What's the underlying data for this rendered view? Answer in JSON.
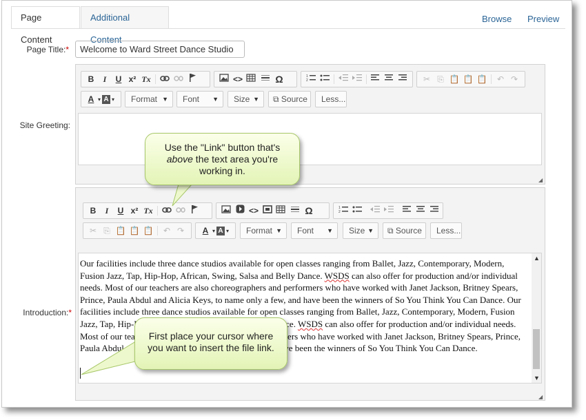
{
  "tabs": [
    {
      "label": "Page Content",
      "active": true
    },
    {
      "label": "Additional Content",
      "active": false
    }
  ],
  "top_links": {
    "browse": "Browse",
    "preview": "Preview"
  },
  "page_title": {
    "label": "Page Title:",
    "required_mark": "*",
    "value": "Welcome to Ward Street Dance Studio"
  },
  "site_greeting": {
    "label": "Site Greeting:"
  },
  "introduction": {
    "label": "Introduction:",
    "required_mark": "*",
    "p1": "Our facilities include three dance studios available for open classes ranging from Ballet, Jazz, Contemporary, Modern, Fusion Jazz, Tap, Hip-Hop, African, Swing, Salsa and Belly Dance. ",
    "wsds": "WSDS",
    "p2": " can also offer for production and/or individual needs. Most of our teachers are also choreographers and performers who have worked with Janet Jackson, Britney Spears, Prince, Paula Abdul and Alicia Keys, to name only a few, and have been the winners of So You Think You Can Dance. Our facilities include three dance studios available for open classes ranging from Ballet, Jazz, Contemporary, Modern, Fusion Jazz, Tap, Hip-Hop, African, Swing, Salsa and Belly Dance. ",
    "p3": " can also offer for production and/or individual needs. Most of our teachers are also choreographers and performers who have worked with Janet Jackson, Britney Spears, Prince, Paula Abdul and Alicia Keys, to name only a few, and have been the winners of So You Think You Can Dance."
  },
  "toolbar": {
    "bold": "B",
    "italic": "I",
    "underline": "U",
    "superscript": "x²",
    "remove_format": "Tx",
    "omega": "Ω",
    "text_color": "A",
    "bg_color": "A",
    "format": "Format",
    "font": "Font",
    "size": "Size",
    "source": "Source",
    "less": "Less..."
  },
  "callouts": {
    "link_tip_1": "Use the \"Link\" button that's",
    "link_tip_em": "above",
    "link_tip_2": " the text area you're working in.",
    "cursor_tip": "First place your cursor where you want to insert the file link."
  },
  "icons": [
    "link-icon",
    "unlink-icon",
    "anchor-flag-icon",
    "image-icon",
    "flash-icon",
    "code-icon",
    "iframe-icon",
    "table-icon",
    "horizontal-rule-icon",
    "special-char-icon",
    "numbered-list-icon",
    "bullet-list-icon",
    "outdent-icon",
    "indent-icon",
    "align-left-icon",
    "align-center-icon",
    "align-right-icon",
    "cut-icon",
    "copy-icon",
    "paste-icon",
    "paste-text-icon",
    "paste-word-icon",
    "undo-icon",
    "redo-icon",
    "source-icon",
    "resize-grip-icon"
  ],
  "colors": {
    "accent_link": "#2a6496",
    "required": "#cc0000",
    "callout_fill": "#e3f4b6",
    "callout_border": "#a8c86a"
  }
}
